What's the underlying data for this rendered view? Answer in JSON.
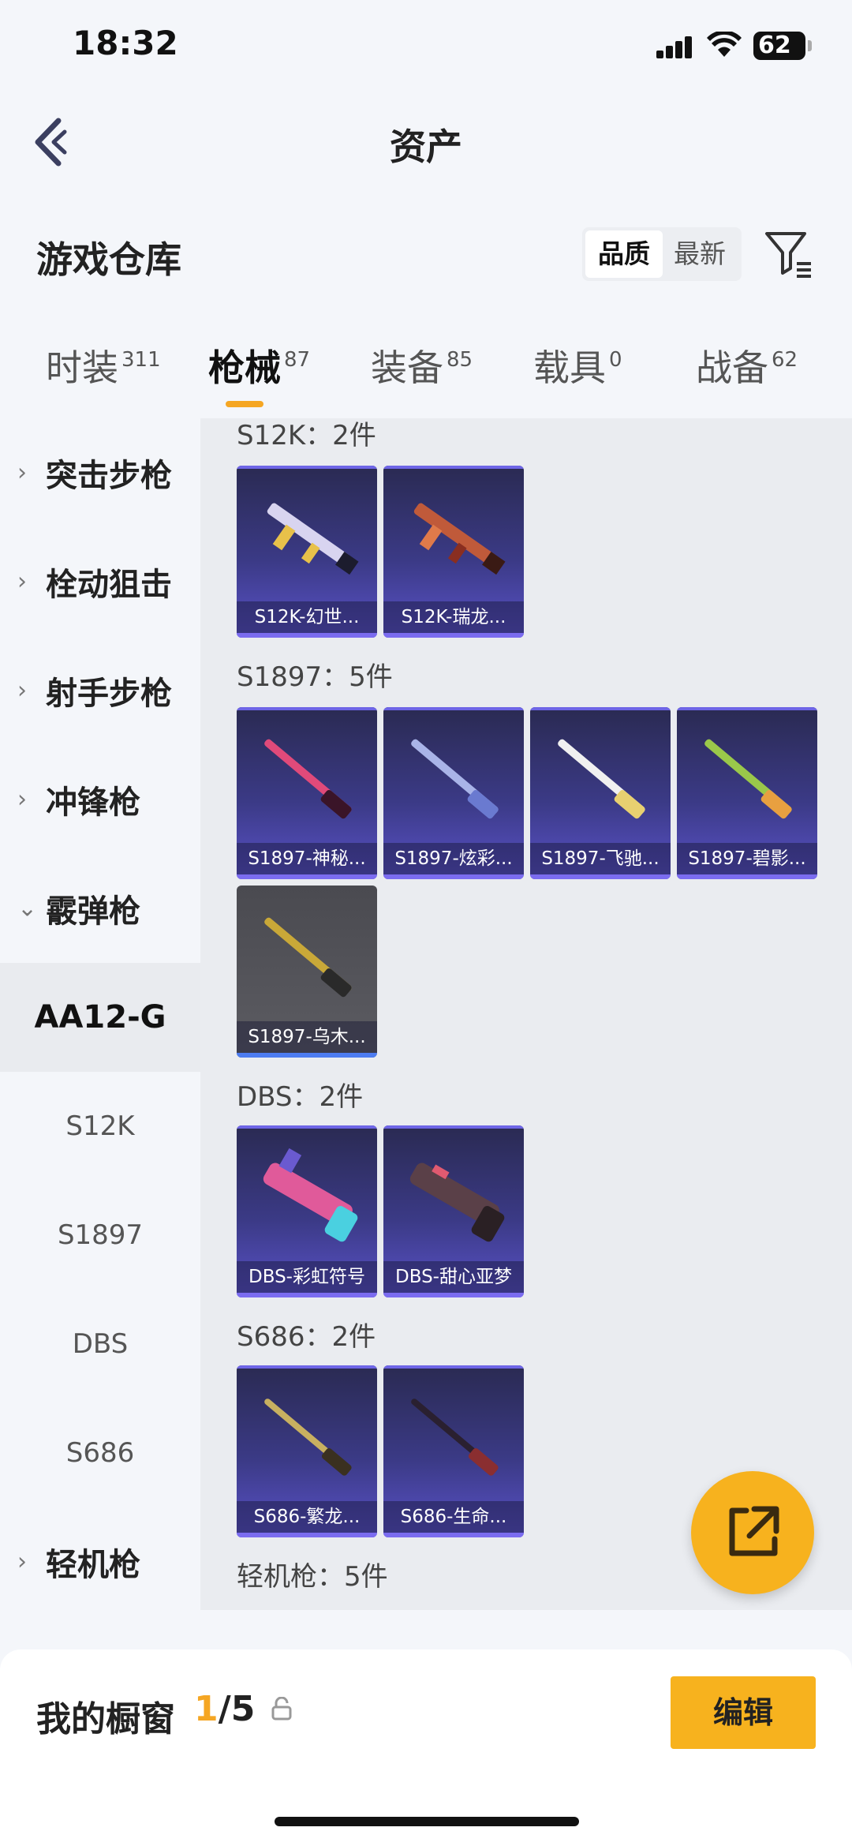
{
  "status": {
    "time": "18:32",
    "battery": "62"
  },
  "header": {
    "title": "资产"
  },
  "warehouse": {
    "title": "游戏仓库",
    "sort_options": [
      "品质",
      "最新"
    ]
  },
  "tabs": [
    {
      "label": "时装",
      "count": "311"
    },
    {
      "label": "枪械",
      "count": "87"
    },
    {
      "label": "装备",
      "count": "85"
    },
    {
      "label": "载具",
      "count": "0"
    },
    {
      "label": "战备",
      "count": "62"
    }
  ],
  "sidebar": {
    "items": [
      {
        "label": "突击步枪",
        "chev": "›"
      },
      {
        "label": "栓动狙击",
        "chev": "›"
      },
      {
        "label": "射手步枪",
        "chev": "›"
      },
      {
        "label": "冲锋枪",
        "chev": "›"
      },
      {
        "label": "霰弹枪",
        "chev": "⌄"
      },
      {
        "label": "AA12-G"
      },
      {
        "label": "S12K"
      },
      {
        "label": "S1897"
      },
      {
        "label": "DBS"
      },
      {
        "label": "S686"
      },
      {
        "label": "轻机枪",
        "chev": "›"
      }
    ]
  },
  "content": {
    "sections": [
      {
        "label": "S12K：2件",
        "items": [
          "S12K-幻世...",
          "S12K-瑞龙..."
        ]
      },
      {
        "label": "S1897：5件",
        "items": [
          "S1897-神秘...",
          "S1897-炫彩...",
          "S1897-飞驰...",
          "S1897-碧影...",
          "S1897-乌木..."
        ]
      },
      {
        "label": "DBS：2件",
        "items": [
          "DBS-彩虹符号",
          "DBS-甜心亚梦"
        ]
      },
      {
        "label": "S686：2件",
        "items": [
          "S686-繁龙...",
          "S686-生命..."
        ]
      },
      {
        "label": "轻机枪：5件"
      }
    ]
  },
  "bottom": {
    "showcase_label": "我的橱窗",
    "showcase_current": "1",
    "showcase_total": "/5",
    "edit_label": "编辑"
  },
  "colors": {
    "accent": "#f7b21e",
    "card_purple": "#3b3a86"
  }
}
